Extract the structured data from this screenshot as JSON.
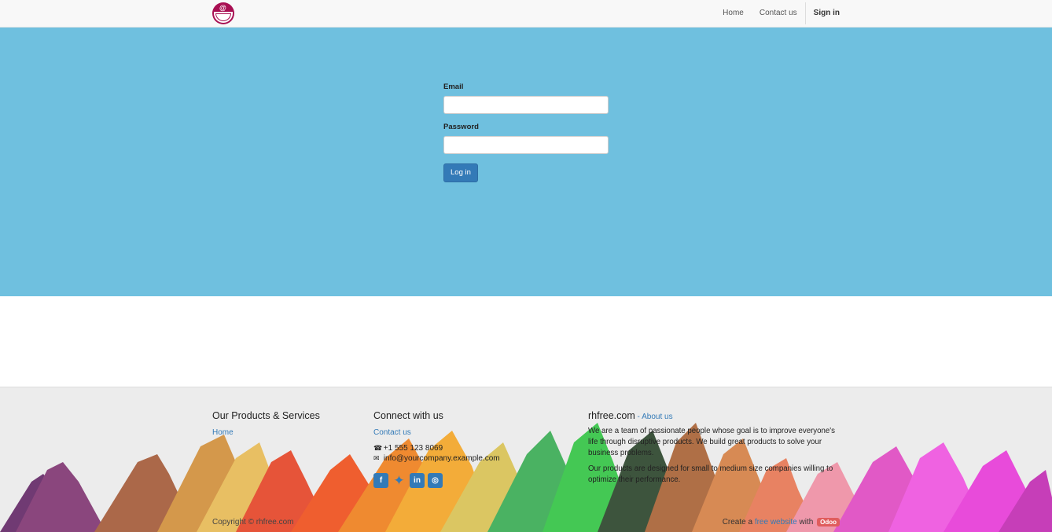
{
  "nav": {
    "home": "Home",
    "contact": "Contact us",
    "signin": "Sign in"
  },
  "login": {
    "email_label": "Email",
    "email_value": "",
    "password_label": "Password",
    "password_value": "",
    "submit": "Log in"
  },
  "footer": {
    "products": {
      "title": "Our Products & Services",
      "home": "Home"
    },
    "connect": {
      "title": "Connect with us",
      "contact": "Contact us",
      "phone": "+1 555 123 8069",
      "email": "info@yourcompany.example.com",
      "social": [
        "facebook-icon",
        "twitter-icon",
        "linkedin-icon",
        "instagram-icon"
      ]
    },
    "about": {
      "title": "rhfree.com",
      "dash": "-",
      "link": "About us",
      "para1": "We are a team of passionate people whose goal is to improve everyone's life through disruptive products. We build great products to solve your business problems.",
      "para2": "Our products are designed for small to medium size companies willing to optimize their performance."
    },
    "copyright": "Copyright © rhfree.com",
    "create_prefix": "Create a",
    "create_link": "free website",
    "create_mid": "with",
    "badge": "Odoo"
  },
  "colors": {
    "hero": "#6fc0df",
    "accent": "#337ab7",
    "logo": "#a80f52",
    "badge": "#e05d5d"
  }
}
